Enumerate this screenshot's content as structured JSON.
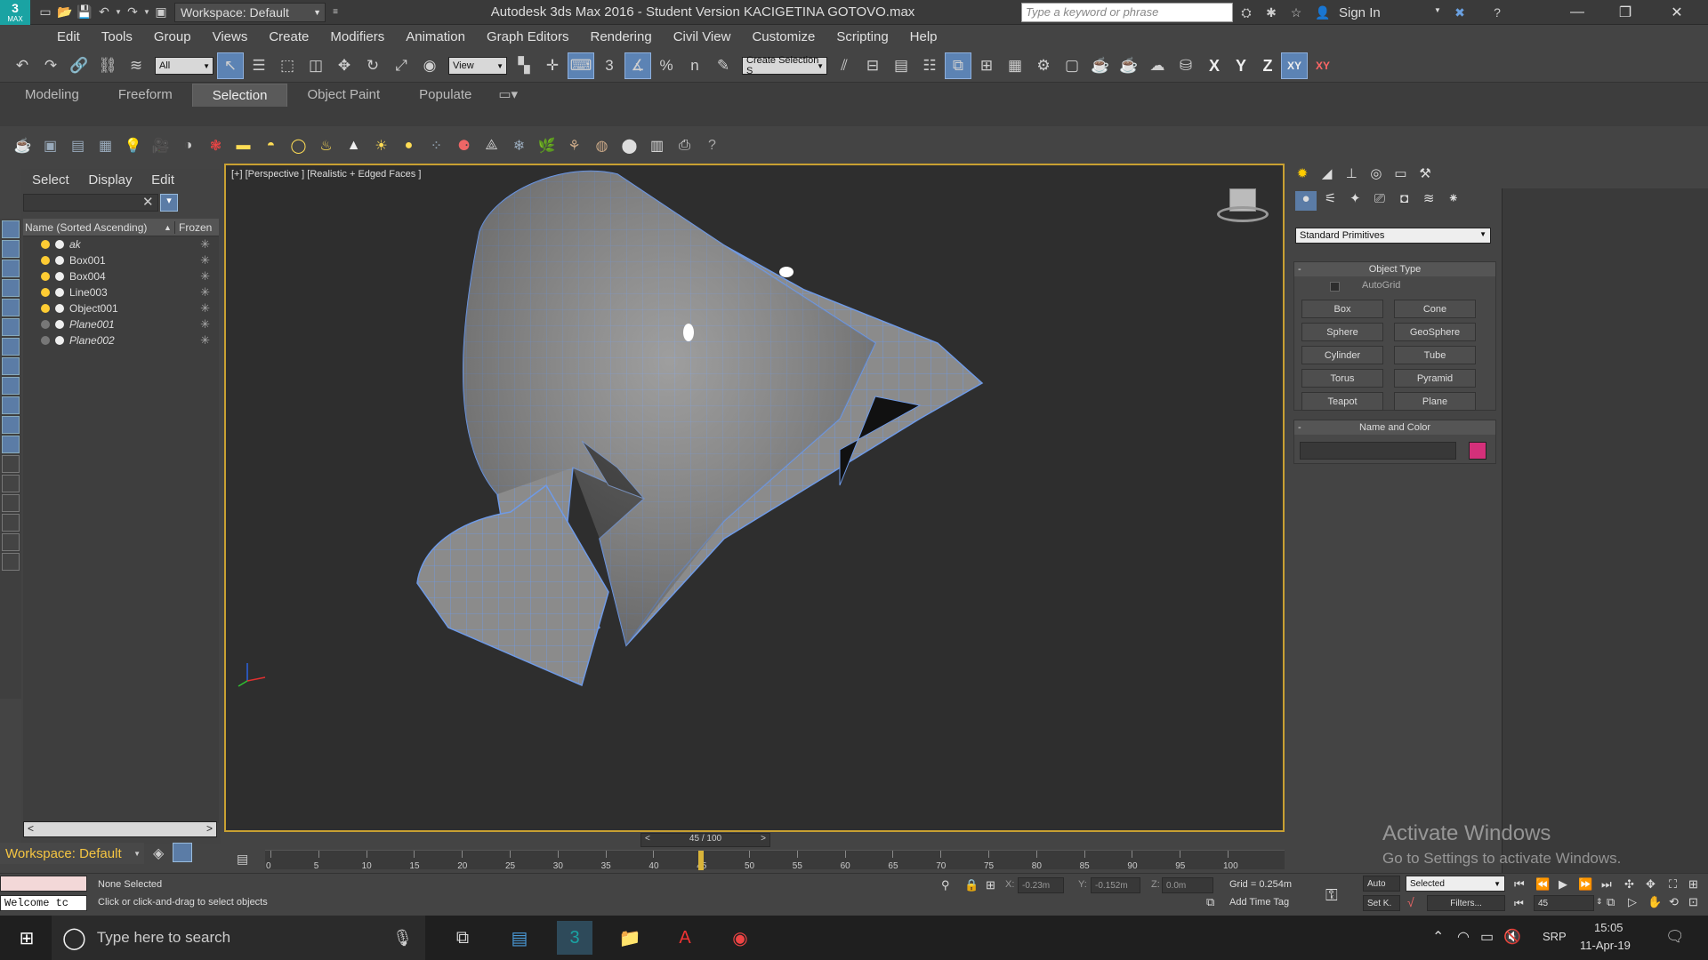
{
  "title_bar": {
    "workspace": "Workspace: Default",
    "app_title": "Autodesk 3ds Max 2016 - Student Version    KACIGETINA GOTOVO.max",
    "search_placeholder": "Type a keyword or phrase",
    "sign_in": "Sign In",
    "logo_text": "MAX"
  },
  "menu": [
    "Edit",
    "Tools",
    "Group",
    "Views",
    "Create",
    "Modifiers",
    "Animation",
    "Graph Editors",
    "Rendering",
    "Civil View",
    "Customize",
    "Scripting",
    "Help"
  ],
  "toolbar": {
    "selection_filter": "All",
    "ref_coord": "View",
    "named_selection": "Create Selection S",
    "axis_x": "X",
    "axis_y": "Y",
    "axis_z": "Z",
    "axis_xy": "XY",
    "axis_xy2": "XY",
    "snap_3": "3",
    "snap_pct": "%",
    "snap_n": "n"
  },
  "ribbon": {
    "tabs": [
      "Modeling",
      "Freeform",
      "Selection",
      "Object Paint",
      "Populate"
    ],
    "active": "Selection"
  },
  "scene_explorer": {
    "menu": [
      "Select",
      "Display",
      "Edit"
    ],
    "col_name": "Name (Sorted Ascending)",
    "col_frozen": "Frozen",
    "sort_arrow": "▲",
    "items": [
      {
        "name": "ak"
      },
      {
        "name": "Box001"
      },
      {
        "name": "Box004"
      },
      {
        "name": "Line003"
      },
      {
        "name": "Object001"
      },
      {
        "name": "Plane001"
      },
      {
        "name": "Plane002"
      }
    ],
    "workspace": "Workspace: Default"
  },
  "viewport": {
    "label": "[+] [Perspective ] [Realistic + Edged Faces ]"
  },
  "command_panel": {
    "category": "Standard Primitives",
    "object_type_title": "Object Type",
    "autogrid": "AutoGrid",
    "primitives": [
      "Box",
      "Cone",
      "Sphere",
      "GeoSphere",
      "Cylinder",
      "Tube",
      "Torus",
      "Pyramid",
      "Teapot",
      "Plane"
    ],
    "name_color_title": "Name and Color",
    "color": "#d4307a"
  },
  "timeline": {
    "frame": "45 / 100",
    "ticks": [
      "0",
      "5",
      "10",
      "15",
      "20",
      "25",
      "30",
      "35",
      "40",
      "45",
      "50",
      "55",
      "60",
      "65",
      "70",
      "75",
      "80",
      "85",
      "90",
      "95",
      "100"
    ],
    "current": 45
  },
  "status": {
    "none_selected": "None Selected",
    "prompt": "Click or click-and-drag to select objects",
    "x_label": "X:",
    "x": "-0.23m",
    "y_label": "Y:",
    "y": "-0.152m",
    "z_label": "Z:",
    "z": "0.0m",
    "grid": "Grid = 0.254m",
    "add_time_tag": "Add Time Tag",
    "auto": "Auto",
    "setk": "Set K.",
    "selected": "Selected",
    "filters": "Filters...",
    "frame_field": "45",
    "listener": "Welcome tc"
  },
  "activate": {
    "line1": "Activate Windows",
    "line2": "Go to Settings to activate Windows."
  },
  "taskbar": {
    "search": "Type here to search",
    "lang": "SRP",
    "time": "15:05",
    "date": "11-Apr-19"
  }
}
